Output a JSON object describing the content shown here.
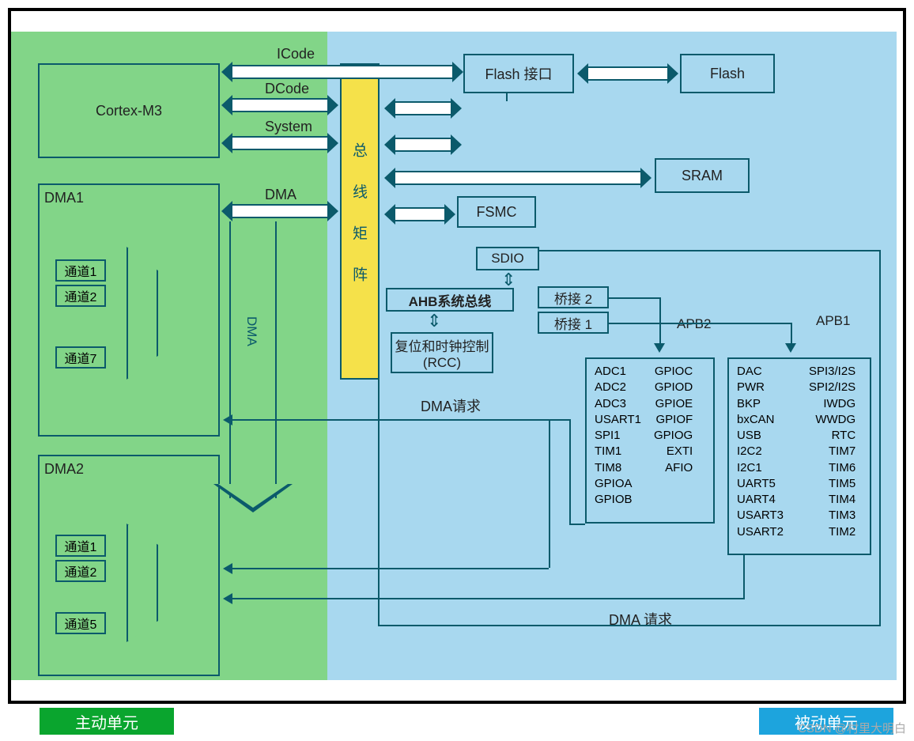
{
  "zones": {
    "active_label": "主动单元",
    "passive_label": "被动单元"
  },
  "center": {
    "bus_matrix": "总 线 矩 阵",
    "icode": "ICode",
    "dcode": "DCode",
    "system": "System",
    "dma_bus": "DMA",
    "dma_vert": "DMA",
    "ahb_bus": "AHB系统总线",
    "rcc": "复位和时钟控制 (RCC)",
    "dma_request_top": "DMA请求",
    "dma_request_bottom": "DMA 请求"
  },
  "cpu": {
    "name": "Cortex-M3"
  },
  "dma1": {
    "title": "DMA1",
    "ch1": "通道1",
    "ch2": "通道2",
    "ch7": "通道7"
  },
  "dma2": {
    "title": "DMA2",
    "ch1": "通道1",
    "ch2": "通道2",
    "ch5": "通道5"
  },
  "slaves": {
    "flash_if": "Flash 接口",
    "flash": "Flash",
    "sram": "SRAM",
    "fsmc": "FSMC",
    "sdio": "SDIO",
    "bridge1": "桥接 1",
    "bridge2": "桥接 2",
    "apb1": "APB1",
    "apb2": "APB2"
  },
  "apb2": {
    "col1": [
      "ADC1",
      "ADC2",
      "ADC3",
      "USART1",
      "SPI1",
      "TIM1",
      "TIM8",
      "GPIOA",
      "GPIOB"
    ],
    "col2": [
      "GPIOC",
      "GPIOD",
      "GPIOE",
      "GPIOF",
      "GPIOG",
      "EXTI",
      "AFIO"
    ]
  },
  "apb1": {
    "col1": [
      "DAC",
      "PWR",
      "BKP",
      "bxCAN",
      "USB",
      "I2C2",
      "I2C1",
      "UART5",
      "UART4",
      "USART3",
      "USART2"
    ],
    "col2": [
      "SPI3/I2S",
      "SPI2/I2S",
      "IWDG",
      "WWDG",
      "RTC",
      "TIM7",
      "TIM6",
      "TIM5",
      "TIM4",
      "TIM3",
      "TIM2"
    ]
  },
  "watermark": "CSDN @村里大明白"
}
